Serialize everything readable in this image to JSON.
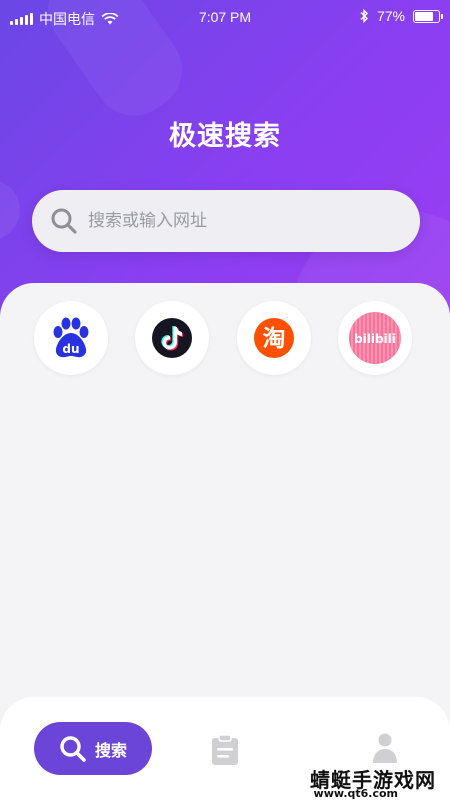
{
  "status_bar": {
    "carrier": "中国电信",
    "time": "7:07 PM",
    "battery_percent": "77%",
    "battery_level": 0.77
  },
  "app": {
    "title": "极速搜索"
  },
  "search": {
    "placeholder": "搜索或输入网址"
  },
  "shortcuts": [
    {
      "name": "baidu",
      "icon": "baidu-paw-icon",
      "glyph": "du",
      "color": "#2932e1"
    },
    {
      "name": "douyin",
      "icon": "tiktok-note-icon",
      "color": "#111111"
    },
    {
      "name": "taobao",
      "icon": "taobao-icon",
      "glyph": "淘",
      "color": "#ff5000"
    },
    {
      "name": "bilibili",
      "icon": "bilibili-icon",
      "glyph": "bilibili",
      "color": "#fb7299"
    }
  ],
  "bottom_nav": {
    "search_label": "搜索",
    "accent": "#6b45d8"
  },
  "watermark": {
    "text": "蜻蜓手游戏网",
    "url": "www.qt6.com"
  }
}
